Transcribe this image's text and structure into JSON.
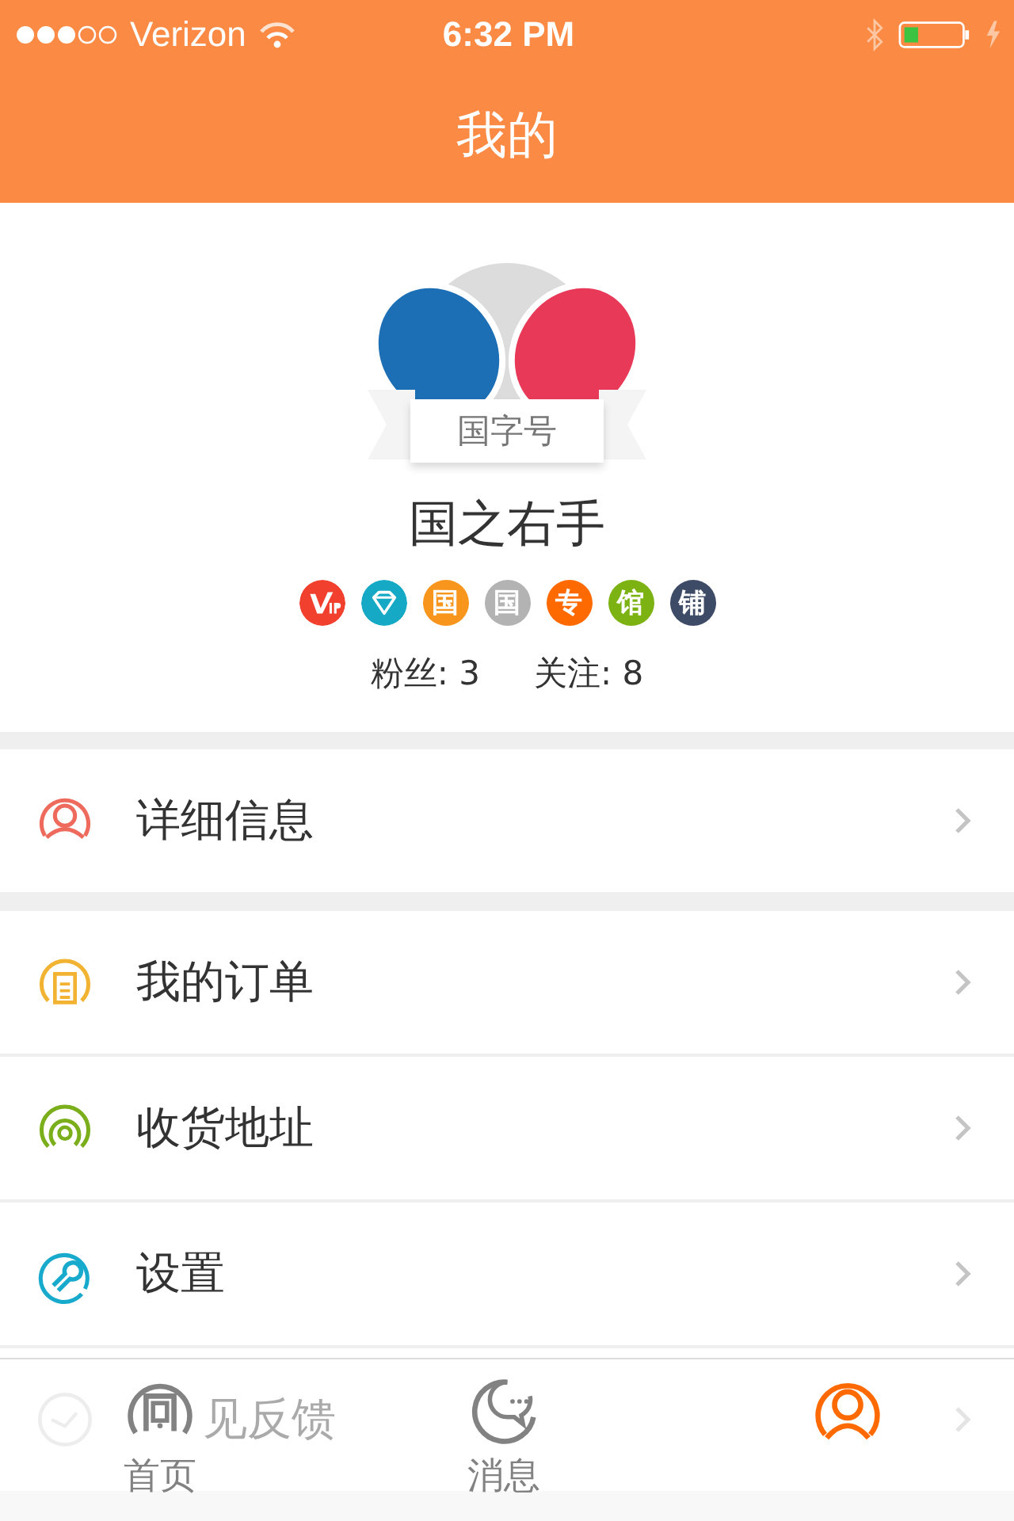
{
  "status_bar": {
    "carrier": "Verizon",
    "time": "6:32 PM"
  },
  "nav": {
    "title": "我的"
  },
  "profile": {
    "ribbon": "国字号",
    "name": "国之右手",
    "badges": [
      {
        "kind": "vip",
        "color": "#f2402f"
      },
      {
        "kind": "diamond",
        "color": "#15a9c6"
      },
      {
        "kind": "text",
        "text": "国",
        "color": "#f8951d"
      },
      {
        "kind": "text",
        "text": "国",
        "color": "#b3b3b3"
      },
      {
        "kind": "text",
        "text": "专",
        "color": "#ff6a00"
      },
      {
        "kind": "text",
        "text": "馆",
        "color": "#7cb212"
      },
      {
        "kind": "text",
        "text": "铺",
        "color": "#3e4b66"
      }
    ],
    "stats": [
      {
        "label": "粉丝: 3"
      },
      {
        "label": "关注: 8"
      }
    ]
  },
  "menu_groups": [
    [
      {
        "kind": "row",
        "label": "详细信息",
        "color": "#ee6a5c"
      }
    ],
    [
      {
        "kind": "row",
        "label": "我的订单",
        "color": "#f3b332"
      },
      {
        "kind": "row",
        "label": "收货地址",
        "color": "#7aae1b"
      },
      {
        "kind": "row",
        "label": "设置",
        "color": "#18aacc"
      },
      {
        "kind": "covered",
        "label": "见反馈"
      }
    ]
  ],
  "tabs": [
    {
      "label": "首页",
      "selected": false
    },
    {
      "label": "消息",
      "selected": false
    },
    {
      "selected": true
    }
  ]
}
